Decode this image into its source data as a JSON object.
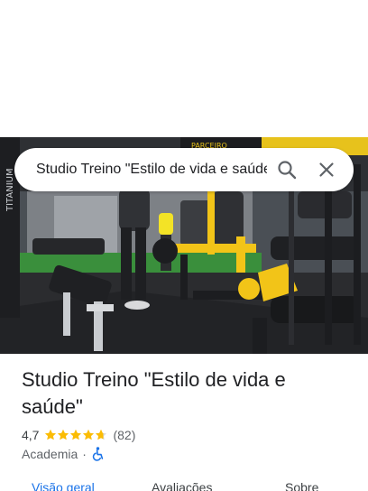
{
  "search": {
    "query": "Studio Treino \"Estilo de vida e saúde\""
  },
  "place": {
    "title": "Studio Treino \"Estilo de vida e saúde\"",
    "rating": "4,7",
    "stars": 4.7,
    "review_count": "(82)",
    "category": "Academia",
    "separator": "·",
    "accessibility_icon": "wheelchair-icon"
  },
  "photo": {
    "signage_left": "TITANIUM",
    "signage_top": "PARCEIRO"
  },
  "tabs": [
    {
      "label": "Visão geral",
      "active": true
    },
    {
      "label": "Avaliações",
      "active": false
    },
    {
      "label": "Sobre",
      "active": false
    }
  ],
  "colors": {
    "accent": "#1a73e8",
    "star": "#fbbc04",
    "machine_yellow": "#f2c418"
  }
}
